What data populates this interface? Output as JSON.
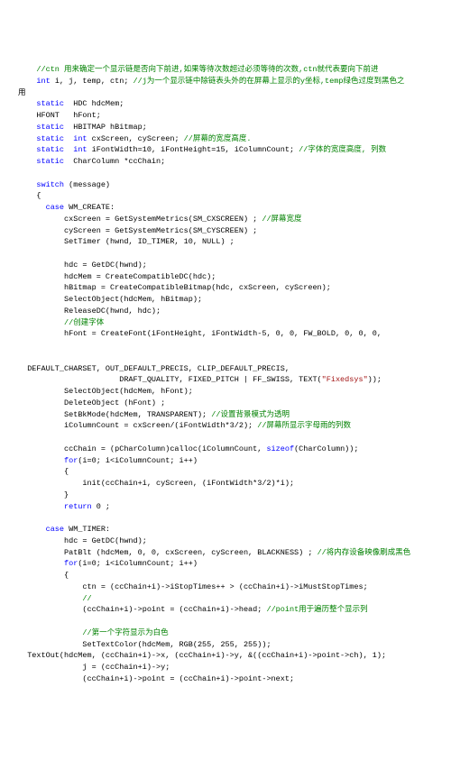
{
  "code_lines": [
    {
      "indent": 4,
      "spans": [
        {
          "cls": "c-comment",
          "text": "//ctn 用来确定一个显示链是否向下前进,如果等待次数超过必须等待的次数,ctn就代表要向下前进"
        }
      ]
    },
    {
      "indent": 4,
      "spans": [
        {
          "cls": "c-keyword",
          "text": "int"
        },
        {
          "cls": "c-plain",
          "text": " i, j, temp, ctn; "
        },
        {
          "cls": "c-comment",
          "text": "//j为一个显示链中除链表头外的在屏幕上显示的y坐标,temp绿色过度到黑色之"
        }
      ]
    },
    {
      "indent": 0,
      "spans": [
        {
          "cls": "c-plain",
          "text": "用"
        }
      ]
    },
    {
      "indent": 4,
      "spans": [
        {
          "cls": "c-keyword",
          "text": "static"
        },
        {
          "cls": "c-plain",
          "text": "  HDC hdcMem;"
        }
      ]
    },
    {
      "indent": 4,
      "spans": [
        {
          "cls": "c-plain",
          "text": "HFONT   hFont;"
        }
      ]
    },
    {
      "indent": 4,
      "spans": [
        {
          "cls": "c-keyword",
          "text": "static"
        },
        {
          "cls": "c-plain",
          "text": "  HBITMAP hBitmap;"
        }
      ]
    },
    {
      "indent": 4,
      "spans": [
        {
          "cls": "c-keyword",
          "text": "static"
        },
        {
          "cls": "c-plain",
          "text": "  "
        },
        {
          "cls": "c-keyword",
          "text": "int"
        },
        {
          "cls": "c-plain",
          "text": " cxScreen, cyScreen; "
        },
        {
          "cls": "c-comment",
          "text": "//屏幕的宽度高度."
        }
      ]
    },
    {
      "indent": 4,
      "spans": [
        {
          "cls": "c-keyword",
          "text": "static"
        },
        {
          "cls": "c-plain",
          "text": "  "
        },
        {
          "cls": "c-keyword",
          "text": "int"
        },
        {
          "cls": "c-plain",
          "text": " iFontWidth=10, iFontHeight=15, iColumnCount; "
        },
        {
          "cls": "c-comment",
          "text": "//字体的宽度高度, 列数"
        }
      ]
    },
    {
      "indent": 4,
      "spans": [
        {
          "cls": "c-keyword",
          "text": "static"
        },
        {
          "cls": "c-plain",
          "text": "  CharColumn *ccChain;"
        }
      ]
    },
    {
      "indent": 0,
      "spans": [
        {
          "cls": "c-plain",
          "text": ""
        }
      ]
    },
    {
      "indent": 4,
      "spans": [
        {
          "cls": "c-keyword",
          "text": "switch"
        },
        {
          "cls": "c-plain",
          "text": " (message)"
        }
      ]
    },
    {
      "indent": 4,
      "spans": [
        {
          "cls": "c-plain",
          "text": "{"
        }
      ]
    },
    {
      "indent": 6,
      "spans": [
        {
          "cls": "c-keyword",
          "text": "case"
        },
        {
          "cls": "c-plain",
          "text": " WM_CREATE:"
        }
      ]
    },
    {
      "indent": 10,
      "spans": [
        {
          "cls": "c-plain",
          "text": "cxScreen = GetSystemMetrics(SM_CXSCREEN) ; "
        },
        {
          "cls": "c-comment",
          "text": "//屏幕宽度"
        }
      ]
    },
    {
      "indent": 10,
      "spans": [
        {
          "cls": "c-plain",
          "text": "cyScreen = GetSystemMetrics(SM_CYSCREEN) ;"
        }
      ]
    },
    {
      "indent": 10,
      "spans": [
        {
          "cls": "c-plain",
          "text": "SetTimer (hwnd, ID_TIMER, 10, NULL) ;"
        }
      ]
    },
    {
      "indent": 0,
      "spans": [
        {
          "cls": "c-plain",
          "text": ""
        }
      ]
    },
    {
      "indent": 10,
      "spans": [
        {
          "cls": "c-plain",
          "text": "hdc = GetDC(hwnd);"
        }
      ]
    },
    {
      "indent": 10,
      "spans": [
        {
          "cls": "c-plain",
          "text": "hdcMem = CreateCompatibleDC(hdc);"
        }
      ]
    },
    {
      "indent": 10,
      "spans": [
        {
          "cls": "c-plain",
          "text": "hBitmap = CreateCompatibleBitmap(hdc, cxScreen, cyScreen);"
        }
      ]
    },
    {
      "indent": 10,
      "spans": [
        {
          "cls": "c-plain",
          "text": "SelectObject(hdcMem, hBitmap);"
        }
      ]
    },
    {
      "indent": 10,
      "spans": [
        {
          "cls": "c-plain",
          "text": "ReleaseDC(hwnd, hdc);"
        }
      ]
    },
    {
      "indent": 10,
      "spans": [
        {
          "cls": "c-comment",
          "text": "//创建字体"
        }
      ]
    },
    {
      "indent": 10,
      "spans": [
        {
          "cls": "c-plain",
          "text": "hFont = CreateFont(iFontHeight, iFontWidth-5, 0, 0, FW_BOLD, 0, 0, 0,"
        }
      ]
    },
    {
      "indent": 0,
      "spans": [
        {
          "cls": "c-plain",
          "text": ""
        }
      ]
    },
    {
      "indent": 0,
      "spans": [
        {
          "cls": "c-plain",
          "text": ""
        }
      ]
    },
    {
      "indent": 2,
      "spans": [
        {
          "cls": "c-plain",
          "text": "DEFAULT_CHARSET, OUT_DEFAULT_PRECIS, CLIP_DEFAULT_PRECIS,"
        }
      ]
    },
    {
      "indent": 22,
      "spans": [
        {
          "cls": "c-plain",
          "text": "DRAFT_QUALITY, FIXED_PITCH | FF_SWISS, TEXT("
        },
        {
          "cls": "c-string",
          "text": "\"Fixedsys\""
        },
        {
          "cls": "c-plain",
          "text": "));"
        }
      ]
    },
    {
      "indent": 10,
      "spans": [
        {
          "cls": "c-plain",
          "text": "SelectObject(hdcMem, hFont);"
        }
      ]
    },
    {
      "indent": 10,
      "spans": [
        {
          "cls": "c-plain",
          "text": "DeleteObject (hFont) ;"
        }
      ]
    },
    {
      "indent": 10,
      "spans": [
        {
          "cls": "c-plain",
          "text": "SetBkMode(hdcMem, TRANSPARENT); "
        },
        {
          "cls": "c-comment",
          "text": "//设置背景模式为透明"
        }
      ]
    },
    {
      "indent": 10,
      "spans": [
        {
          "cls": "c-plain",
          "text": "iColumnCount = cxScreen/(iFontWidth*3/2); "
        },
        {
          "cls": "c-comment",
          "text": "//屏幕所显示字母雨的列数"
        }
      ]
    },
    {
      "indent": 0,
      "spans": [
        {
          "cls": "c-plain",
          "text": ""
        }
      ]
    },
    {
      "indent": 10,
      "spans": [
        {
          "cls": "c-plain",
          "text": "ccChain = (pCharColumn)calloc(iColumnCount, "
        },
        {
          "cls": "c-keyword",
          "text": "sizeof"
        },
        {
          "cls": "c-plain",
          "text": "(CharColumn));"
        }
      ]
    },
    {
      "indent": 10,
      "spans": [
        {
          "cls": "c-keyword",
          "text": "for"
        },
        {
          "cls": "c-plain",
          "text": "(i=0; i<iColumnCount; i++)"
        }
      ]
    },
    {
      "indent": 10,
      "spans": [
        {
          "cls": "c-plain",
          "text": "{"
        }
      ]
    },
    {
      "indent": 14,
      "spans": [
        {
          "cls": "c-plain",
          "text": "init(ccChain+i, cyScreen, (iFontWidth*3/2)*i);"
        }
      ]
    },
    {
      "indent": 10,
      "spans": [
        {
          "cls": "c-plain",
          "text": "}"
        }
      ]
    },
    {
      "indent": 10,
      "spans": [
        {
          "cls": "c-keyword",
          "text": "return"
        },
        {
          "cls": "c-plain",
          "text": " 0 ;"
        }
      ]
    },
    {
      "indent": 0,
      "spans": [
        {
          "cls": "c-plain",
          "text": ""
        }
      ]
    },
    {
      "indent": 6,
      "spans": [
        {
          "cls": "c-keyword",
          "text": "case"
        },
        {
          "cls": "c-plain",
          "text": " WM_TIMER:"
        }
      ]
    },
    {
      "indent": 10,
      "spans": [
        {
          "cls": "c-plain",
          "text": "hdc = GetDC(hwnd);"
        }
      ]
    },
    {
      "indent": 10,
      "spans": [
        {
          "cls": "c-plain",
          "text": "PatBlt (hdcMem, 0, 0, cxScreen, cyScreen, BLACKNESS) ; "
        },
        {
          "cls": "c-comment",
          "text": "//将内存设备映像刷成黑色"
        }
      ]
    },
    {
      "indent": 10,
      "spans": [
        {
          "cls": "c-keyword",
          "text": "for"
        },
        {
          "cls": "c-plain",
          "text": "(i=0; i<iColumnCount; i++)"
        }
      ]
    },
    {
      "indent": 10,
      "spans": [
        {
          "cls": "c-plain",
          "text": "{"
        }
      ]
    },
    {
      "indent": 14,
      "spans": [
        {
          "cls": "c-plain",
          "text": "ctn = (ccChain+i)->iStopTimes++ > (ccChain+i)->iMustStopTimes;"
        }
      ]
    },
    {
      "indent": 14,
      "spans": [
        {
          "cls": "c-comment",
          "text": "//"
        }
      ]
    },
    {
      "indent": 14,
      "spans": [
        {
          "cls": "c-plain",
          "text": "(ccChain+i)->point = (ccChain+i)->head; "
        },
        {
          "cls": "c-comment",
          "text": "//point用于遍历整个显示列"
        }
      ]
    },
    {
      "indent": 0,
      "spans": [
        {
          "cls": "c-plain",
          "text": ""
        }
      ]
    },
    {
      "indent": 14,
      "spans": [
        {
          "cls": "c-comment",
          "text": "//第一个字符显示为白色"
        }
      ]
    },
    {
      "indent": 14,
      "spans": [
        {
          "cls": "c-plain",
          "text": "SetTextColor(hdcMem, RGB(255, 255, 255));"
        }
      ]
    },
    {
      "indent": 2,
      "spans": [
        {
          "cls": "c-plain",
          "text": "TextOut(hdcMem, (ccChain+i)->x, (ccChain+i)->y, &((ccChain+i)->point->ch), 1);"
        }
      ]
    },
    {
      "indent": 14,
      "spans": [
        {
          "cls": "c-plain",
          "text": "j = (ccChain+i)->y;"
        }
      ]
    },
    {
      "indent": 14,
      "spans": [
        {
          "cls": "c-plain",
          "text": "(ccChain+i)->point = (ccChain+i)->point->next;"
        }
      ]
    }
  ]
}
